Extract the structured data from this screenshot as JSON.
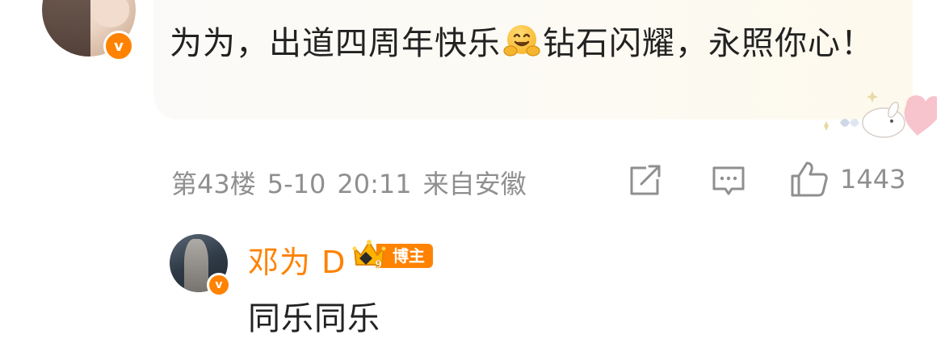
{
  "comment": {
    "text_before_emoji": "为为，出道四周年快乐",
    "emoji": "hugging-face-emoji",
    "text_after_emoji": "钻石闪耀，永照你心！",
    "verified_badge": "v",
    "floor": "第43楼",
    "date": "5-10",
    "time": "20:11",
    "location": "来自安徽",
    "like_count": "1443"
  },
  "reply": {
    "author": "邓为 D",
    "verified_badge": "v",
    "role_badge": "博主",
    "crown_level": "9",
    "text": "同乐同乐"
  },
  "colors": {
    "accent": "#ff8200",
    "meta_text": "#8f8f8f",
    "body_text": "#222222"
  },
  "icons": [
    "share-icon",
    "comment-icon",
    "like-icon",
    "crown-icon",
    "bunny-heart-decoration"
  ]
}
